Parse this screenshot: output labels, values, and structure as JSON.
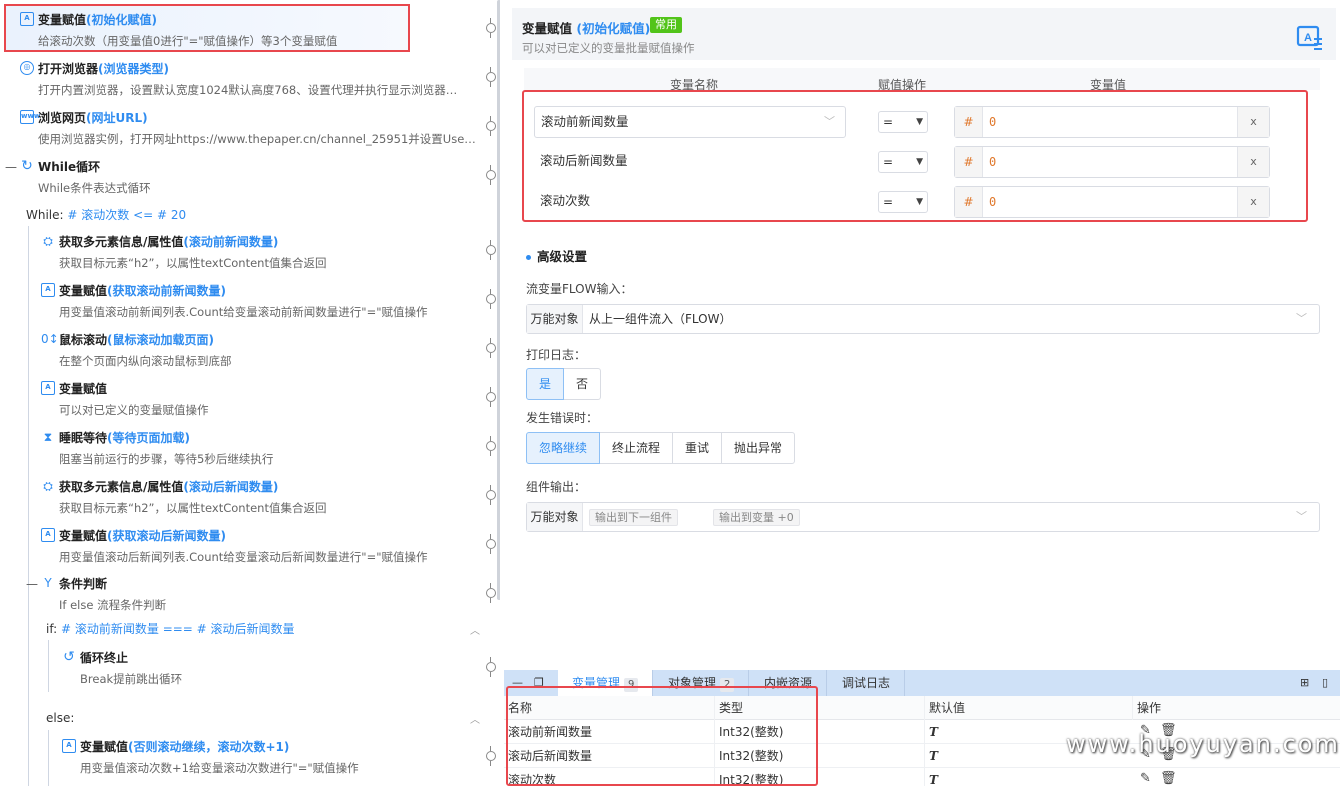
{
  "steps": [
    {
      "title": "变量赋值",
      "sub": "(初始化赋值)",
      "desc": "给滚动次数（用变量值0进行\"=\"赋值操作）等3个变量赋值",
      "icon": "variable-assign-icon"
    },
    {
      "title": "打开浏览器",
      "sub": "(浏览器类型)",
      "desc": "打开内置浏览器，设置默认宽度1024默认高度768、设置代理并执行显示浏览器…",
      "icon": "browser-icon"
    },
    {
      "title": "浏览网页",
      "sub": "(网址URL)",
      "desc": "使用浏览器实例，打开网址https://www.thepaper.cn/channel_25951并设置User…",
      "icon": "webpage-icon"
    },
    {
      "title": "While循环",
      "sub": "",
      "desc": "While条件表达式循环",
      "icon": "loop-icon"
    },
    {
      "title": "获取多元素信息/属性值",
      "sub": "(滚动前新闻数量)",
      "desc": "获取目标元素“h2”，以属性textContent值集合返回",
      "icon": "elements-icon"
    },
    {
      "title": "变量赋值",
      "sub": "(获取滚动前新闻数量)",
      "desc": "用变量值滚动前新闻列表.Count给变量滚动前新闻数量进行\"=\"赋值操作",
      "icon": "variable-assign-icon"
    },
    {
      "title": "鼠标滚动",
      "sub": "(鼠标滚动加载页面)",
      "desc": "在整个页面内纵向滚动鼠标到底部",
      "icon": "mouse-scroll-icon"
    },
    {
      "title": "变量赋值",
      "sub": "",
      "desc": "可以对已定义的变量赋值操作",
      "icon": "variable-assign-icon"
    },
    {
      "title": "睡眠等待",
      "sub": "(等待页面加载)",
      "desc": "阻塞当前运行的步骤，等待5秒后继续执行",
      "icon": "hourglass-icon"
    },
    {
      "title": "获取多元素信息/属性值",
      "sub": "(滚动后新闻数量)",
      "desc": "获取目标元素“h2”，以属性textContent值集合返回",
      "icon": "elements-icon"
    },
    {
      "title": "变量赋值",
      "sub": "(获取滚动后新闻数量)",
      "desc": "用变量值滚动后新闻列表.Count给变量滚动后新闻数量进行\"=\"赋值操作",
      "icon": "variable-assign-icon"
    },
    {
      "title": "条件判断",
      "sub": "",
      "desc": "If else 流程条件判断",
      "icon": "condition-icon"
    },
    {
      "title": "循环终止",
      "sub": "",
      "desc": "Break提前跳出循环",
      "icon": "loop-break-icon"
    },
    {
      "title": "变量赋值",
      "sub": "(否则滚动继续，滚动次数+1)",
      "desc": "用变量值滚动次数+1给变量滚动次数进行\"=\"赋值操作",
      "icon": "variable-assign-icon"
    }
  ],
  "while_cond": {
    "label": "While:",
    "expr": "# 滚动次数 <= # 20"
  },
  "if_cond": {
    "label": "if:",
    "expr": "# 滚动前新闻数量 === # 滚动后新闻数量"
  },
  "else_label": "else:",
  "header": {
    "title": "变量赋值",
    "sub": "(初始化赋值)",
    "badge": "常用",
    "desc": "可以对已定义的变量批量赋值操作"
  },
  "assign_table": {
    "cols": [
      "变量名称",
      "赋值操作",
      "变量值"
    ],
    "rows": [
      {
        "name": "滚动前新闻数量",
        "op": "=",
        "hash": "#",
        "value": "0",
        "x": "x"
      },
      {
        "name": "滚动后新闻数量",
        "op": "=",
        "hash": "#",
        "value": "0",
        "x": "x"
      },
      {
        "name": "滚动次数",
        "op": "=",
        "hash": "#",
        "value": "0",
        "x": "x"
      }
    ]
  },
  "advanced": {
    "title": "高级设置",
    "flow_label": "流变量FLOW输入：",
    "flow_prefix": "万能对象",
    "flow_value": "从上一组件流入（FLOW）",
    "log_label": "打印日志：",
    "log_options": [
      "是",
      "否"
    ],
    "err_label": "发生错误时：",
    "err_options": [
      "忽略继续",
      "终止流程",
      "重试",
      "抛出异常"
    ],
    "out_label": "组件输出：",
    "out_prefix": "万能对象",
    "out_tags": [
      "输出到下一组件",
      "输出到变量 +0"
    ]
  },
  "bottom": {
    "tabs": [
      {
        "label": "变量管理",
        "count": "9"
      },
      {
        "label": "对象管理",
        "count": "2"
      },
      {
        "label": "内嵌资源",
        "count": ""
      },
      {
        "label": "调试日志",
        "count": ""
      }
    ],
    "cols": [
      "名称",
      "类型",
      "默认值",
      "操作"
    ],
    "rows": [
      {
        "name": "滚动前新闻数量",
        "type": "Int32(整数)",
        "default": "T"
      },
      {
        "name": "滚动后新闻数量",
        "type": "Int32(整数)",
        "default": "T"
      },
      {
        "name": "滚动次数",
        "type": "Int32(整数)",
        "default": "T"
      }
    ]
  },
  "watermark": "www.huoyuyan.com",
  "colors": {
    "accent": "#2f8cf0",
    "highlight": "#e8474d",
    "badge": "#52c41a",
    "value": "#e0782c"
  }
}
